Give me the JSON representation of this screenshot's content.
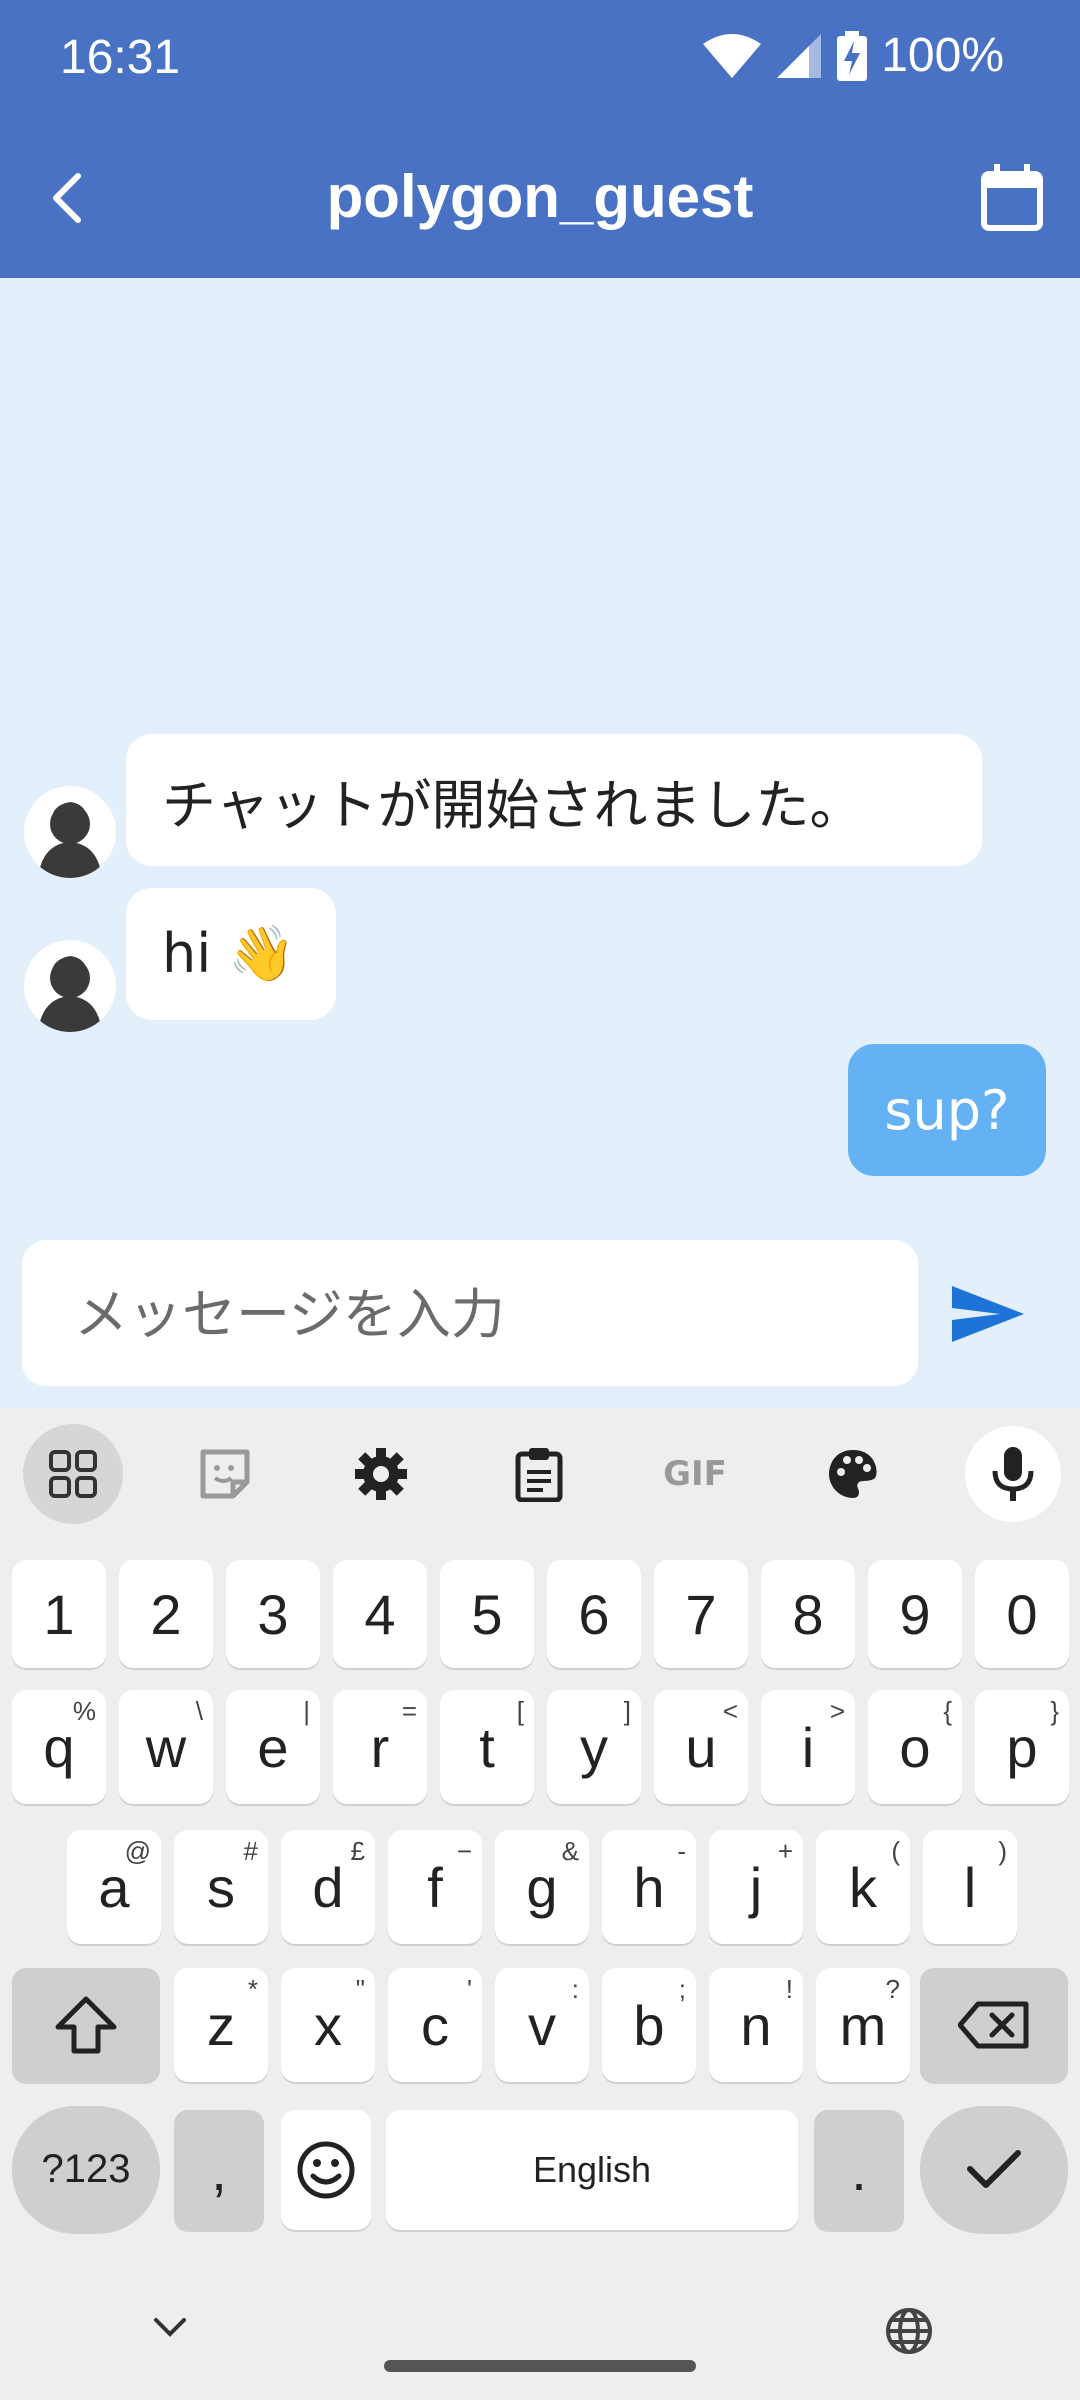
{
  "status": {
    "time": "16:31",
    "battery": "100%"
  },
  "header": {
    "title": "polygon_guest"
  },
  "messages": [
    {
      "from": "them",
      "text": "チャットが開始されました。"
    },
    {
      "from": "them",
      "text": "hi 👋"
    },
    {
      "from": "me",
      "text": "sup?"
    }
  ],
  "composer": {
    "placeholder": "メッセージを入力"
  },
  "keyboard": {
    "toolbar": [
      "apps-grid-icon",
      "sticker-icon",
      "gear-icon",
      "clipboard-icon",
      "gif-icon",
      "palette-icon",
      "mic-icon"
    ],
    "gif_label": "GIF",
    "number_row": [
      "1",
      "2",
      "3",
      "4",
      "5",
      "6",
      "7",
      "8",
      "9",
      "0"
    ],
    "row1": [
      {
        "k": "q",
        "h": "%"
      },
      {
        "k": "w",
        "h": "\\"
      },
      {
        "k": "e",
        "h": "|"
      },
      {
        "k": "r",
        "h": "="
      },
      {
        "k": "t",
        "h": "["
      },
      {
        "k": "y",
        "h": "]"
      },
      {
        "k": "u",
        "h": "<"
      },
      {
        "k": "i",
        "h": ">"
      },
      {
        "k": "o",
        "h": "{"
      },
      {
        "k": "p",
        "h": "}"
      }
    ],
    "row2": [
      {
        "k": "a",
        "h": "@"
      },
      {
        "k": "s",
        "h": "#"
      },
      {
        "k": "d",
        "h": "£"
      },
      {
        "k": "f",
        "h": "−"
      },
      {
        "k": "g",
        "h": "&"
      },
      {
        "k": "h",
        "h": "-"
      },
      {
        "k": "j",
        "h": "+"
      },
      {
        "k": "k",
        "h": "("
      },
      {
        "k": "l",
        "h": ")"
      }
    ],
    "row3": [
      {
        "k": "z",
        "h": "*"
      },
      {
        "k": "x",
        "h": "\""
      },
      {
        "k": "c",
        "h": "'"
      },
      {
        "k": "v",
        "h": ":"
      },
      {
        "k": "b",
        "h": ";"
      },
      {
        "k": "n",
        "h": "!"
      },
      {
        "k": "m",
        "h": "?"
      }
    ],
    "symbols_label": "?123",
    "comma": ",",
    "space_label": "English",
    "period": "."
  }
}
